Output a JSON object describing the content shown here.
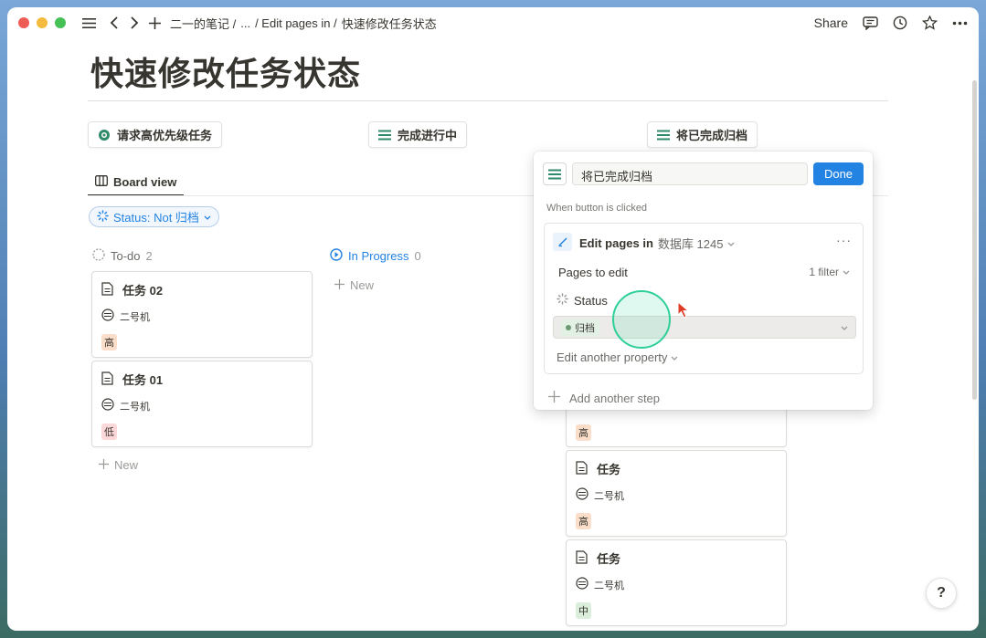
{
  "colors": {
    "accent": "#2383e2",
    "window_red": "#ee5d55",
    "window_yellow": "#f4bb3f",
    "window_green": "#46c156",
    "tag_high": "#fadec9",
    "tag_low": "#fdd8d8",
    "tag_mid": "#dbeddb"
  },
  "topbar": {
    "breadcrumbs": [
      "二一的笔记 /",
      "...",
      "/ Edit pages in /",
      "快速修改任务状态"
    ],
    "share_label": "Share",
    "icons": [
      "hamburger-icon",
      "back-icon",
      "forward-icon",
      "plus-icon",
      "comment-icon",
      "history-icon",
      "star-icon",
      "more-icon"
    ]
  },
  "page": {
    "title": "快速修改任务状态",
    "buttons": [
      "请求高优先级任务",
      "完成进行中",
      "将已完成归档"
    ],
    "tab_label": "Board view",
    "filter_label": "Status: Not 归档"
  },
  "board": {
    "columns": [
      {
        "label": "To-do",
        "count": "2"
      },
      {
        "label": "In Progress",
        "count": "0"
      }
    ],
    "new_label": "New",
    "todo_cards": [
      {
        "title": "任务 02",
        "machine": "二号机",
        "priority": "高"
      },
      {
        "title": "任务 01",
        "machine": "二号机",
        "priority": "低"
      }
    ],
    "right_cards": [
      {
        "title": "",
        "machine": "",
        "priority": "高"
      },
      {
        "title": "任务",
        "machine": "二号机",
        "priority": "高"
      },
      {
        "title": "任务",
        "machine": "二号机",
        "priority": "中"
      }
    ]
  },
  "popup": {
    "name_value": "将已完成归档",
    "done_label": "Done",
    "when_label": "When button is clicked",
    "step_title": "Edit pages in",
    "step_db": "数据库 1245",
    "pages_to_edit": "Pages to edit",
    "filter_count": "1 filter",
    "status_label": "Status",
    "status_value": "归档",
    "edit_another": "Edit another property",
    "add_step": "Add another step"
  },
  "help_label": "?"
}
